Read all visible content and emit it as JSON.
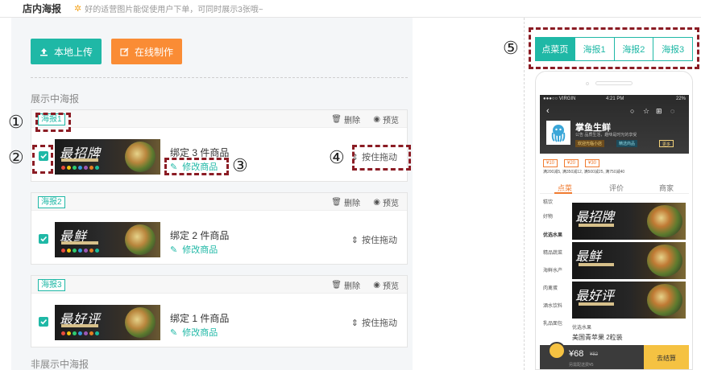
{
  "header": {
    "title": "店内海报",
    "tip": "好的适营图片能促使用户下单，可同时展示3张哦~"
  },
  "toolbar": {
    "upload_label": "本地上传",
    "online_label": "在线制作"
  },
  "sections": {
    "showing_title": "展示中海报",
    "hidden_title": "非展示中海报"
  },
  "posters": [
    {
      "tag": "海报1",
      "delete": "删除",
      "preview": "预览",
      "bind_text": "绑定 3 件商品",
      "edit_text": "修改商品",
      "drag_text": "按住拖动",
      "calligraphy": "最招牌",
      "checked": true
    },
    {
      "tag": "海报2",
      "delete": "删除",
      "preview": "预览",
      "bind_text": "绑定 2 件商品",
      "edit_text": "修改商品",
      "drag_text": "按住拖动",
      "calligraphy": "最鲜",
      "checked": true
    },
    {
      "tag": "海报3",
      "delete": "删除",
      "preview": "预览",
      "bind_text": "绑定 1 件商品",
      "edit_text": "修改商品",
      "drag_text": "按住拖动",
      "calligraphy": "最好评",
      "checked": true
    }
  ],
  "annotations": [
    "①",
    "②",
    "③",
    "④",
    "⑤"
  ],
  "preview_tabs": {
    "active": 0,
    "items": [
      "点菜页",
      "海报1",
      "海报2",
      "海报3"
    ]
  },
  "phone": {
    "status": {
      "carrier": "●●●○○ VIRGIN",
      "time": "4:21 PM",
      "battery": "22%"
    },
    "shop_name": "掌鱼生鲜",
    "shop_info": "公告 品质生活，趣味是时光的享受",
    "badges": [
      "欢迎光临小店",
      "精选商品",
      "更多"
    ],
    "coupons": [
      "¥10",
      "¥20",
      "¥30"
    ],
    "promo": "满200减5, 满350减12, 满500减25, 满750减40",
    "menu_tabs": [
      "点菜",
      "评价",
      "商家"
    ],
    "categories": [
      "糕饮",
      "好物",
      "优选水果",
      "精品蔬菜",
      "海鲜水产",
      "肉禽蛋",
      "酒水饮料",
      "乳品面包",
      "优选水果"
    ],
    "product_title": "美国青苹果 2粒装",
    "cart": {
      "price": "¥68",
      "old_price": "¥82",
      "note": "另需配送费¥5",
      "pay": "去结算"
    }
  },
  "colors": {
    "accent": "#1fb8a6",
    "orange": "#fa8c35",
    "annotation": "#8b1c24"
  }
}
